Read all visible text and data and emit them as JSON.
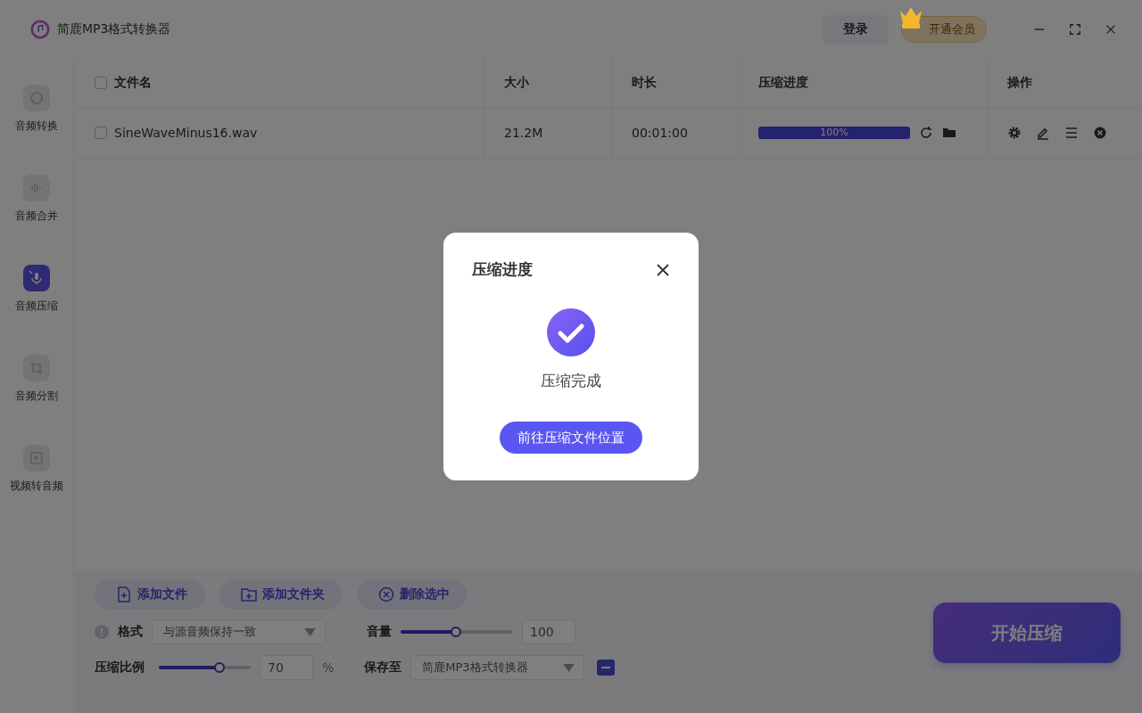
{
  "window": {
    "title": "简鹿MP3格式转换器",
    "login": "登录",
    "vip": "开通会员"
  },
  "sidebar": {
    "items": [
      {
        "label": "音频转换",
        "selected": false
      },
      {
        "label": "音频合并",
        "selected": false
      },
      {
        "label": "音频压缩",
        "selected": true
      },
      {
        "label": "音频分割",
        "selected": false
      },
      {
        "label": "视频转音频",
        "selected": false
      }
    ]
  },
  "table": {
    "select_all_checked": false,
    "columns": [
      "文件名",
      "大小",
      "时长",
      "压缩进度",
      "操作"
    ],
    "rows": [
      {
        "checked": false,
        "name": "SineWaveMinus16.wav",
        "size": "21.2M",
        "duration": "00:01:00",
        "progress": {
          "level": 1,
          "label": "100%"
        }
      }
    ]
  },
  "toolbar": {
    "buttons": [
      {
        "label": "添加文件"
      },
      {
        "label": "添加文件夹"
      },
      {
        "label": "删除选中"
      }
    ]
  },
  "settings": {
    "format_label": "格式",
    "format_value": "与源音频保持一致",
    "volume_label": "音量",
    "volume": {
      "level": 0.49,
      "value": "100"
    },
    "ratio_label": "压缩比例",
    "ratio": {
      "level": 0.66,
      "value": "70",
      "unit": "%"
    },
    "save_label": "保存至",
    "save_value": "简鹿MP3格式转换器"
  },
  "start_button": "开始压缩",
  "dialog": {
    "title": "压缩进度",
    "message": "压缩完成",
    "button": "前往压缩文件位置"
  }
}
